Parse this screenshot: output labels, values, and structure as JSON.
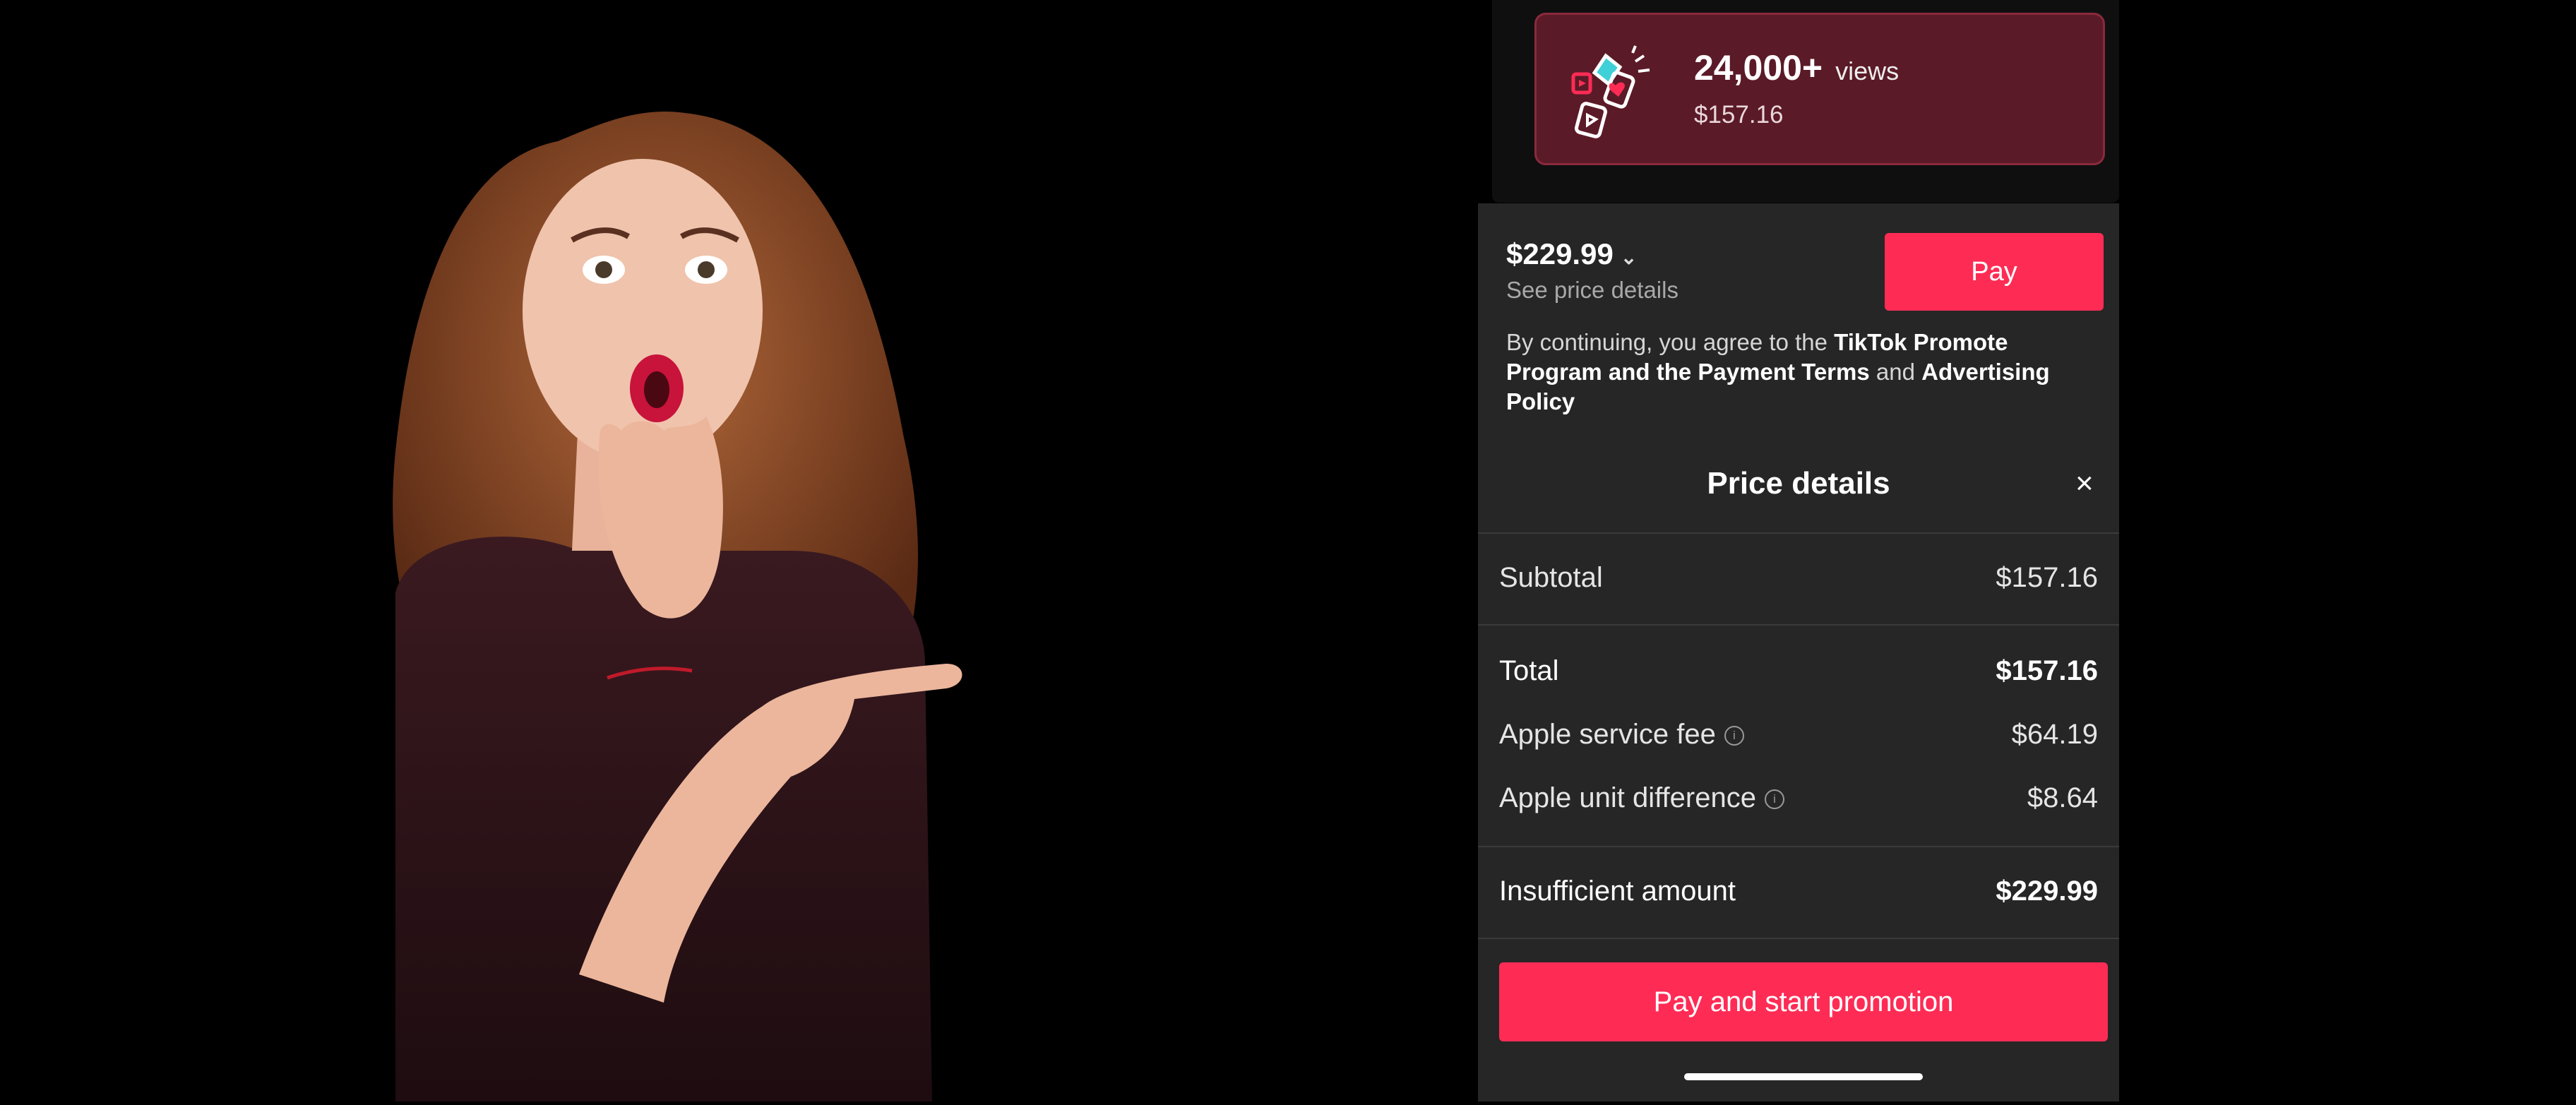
{
  "package": {
    "views_count": "24,000+",
    "views_unit": "views",
    "price": "$157.16"
  },
  "checkout": {
    "amount": "$229.99",
    "see_details": "See price details",
    "pay_label": "Pay",
    "terms_prefix": "By continuing, you agree to the ",
    "terms_link1": "TikTok Promote Program and the Payment Terms",
    "terms_and": " and ",
    "terms_link2": "Advertising Policy"
  },
  "price_details": {
    "title": "Price details",
    "close_icon": "×",
    "subtotal_label": "Subtotal",
    "subtotal_value": "$157.16",
    "total_label": "Total",
    "total_value": "$157.16",
    "apple_fee_label": "Apple service fee",
    "apple_fee_value": "$64.19",
    "apple_diff_label": "Apple unit difference",
    "apple_diff_value": "$8.64",
    "insufficient_label": "Insufficient amount",
    "insufficient_value": "$229.99",
    "info_icon": "i",
    "start_button_label": "Pay and start promotion"
  },
  "colors": {
    "accent": "#fe2c55",
    "card_bg": "#5b1a27",
    "sheet_bg": "#262626"
  }
}
